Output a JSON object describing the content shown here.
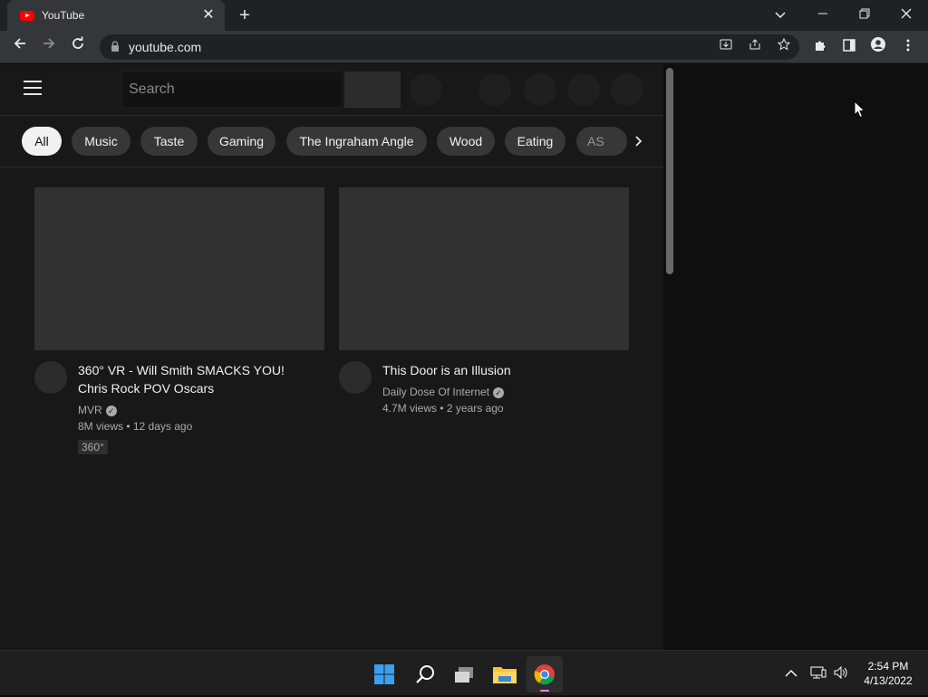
{
  "browser": {
    "tab_title": "YouTube",
    "tab_close": "✕",
    "new_tab": "+",
    "url": "youtube.com"
  },
  "youtube": {
    "search_placeholder": "Search",
    "chips": [
      {
        "label": "All",
        "active": true
      },
      {
        "label": "Music"
      },
      {
        "label": "Taste"
      },
      {
        "label": "Gaming"
      },
      {
        "label": "The Ingraham Angle"
      },
      {
        "label": "Wood"
      },
      {
        "label": "Eating"
      },
      {
        "label": "AS"
      }
    ],
    "videos": [
      {
        "title_line1": "360° VR - Will Smith SMACKS YOU!",
        "title_line2": "Chris Rock POV Oscars",
        "channel": "MVR",
        "meta": "8M views • 12 days ago",
        "badge": "360°"
      },
      {
        "title_line1": "This Door is an Illusion",
        "channel": "Daily Dose Of Internet",
        "meta": "4.7M views • 2 years ago"
      }
    ]
  },
  "taskbar": {
    "time": "2:54 PM",
    "date": "4/13/2022"
  },
  "colors": {
    "brand_red": "#ff0000",
    "page_bg": "#181818",
    "chip_bg": "#373737",
    "chip_active_bg": "#f1f1f1"
  }
}
